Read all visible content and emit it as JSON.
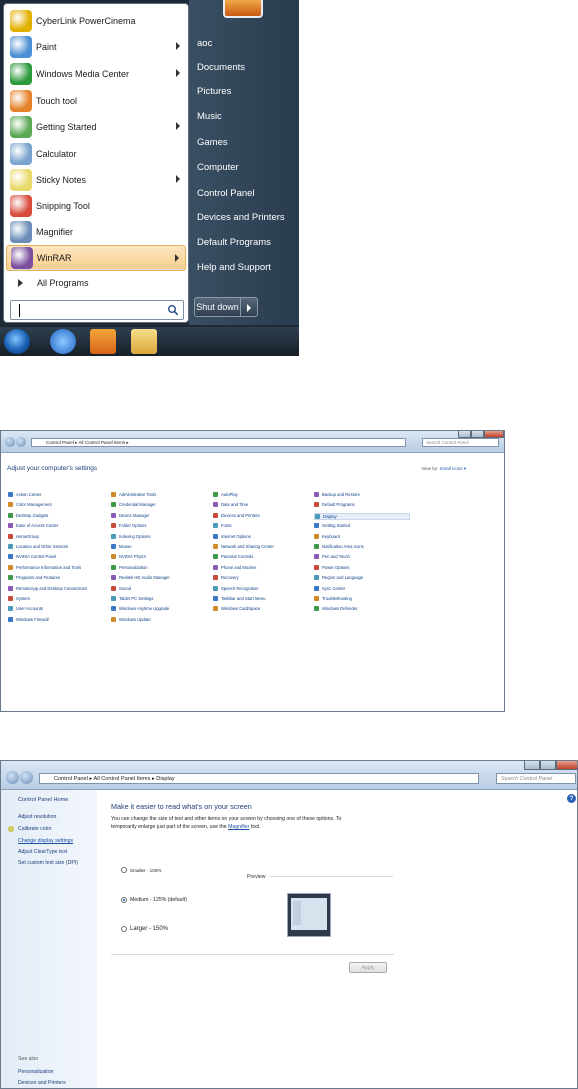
{
  "start_menu": {
    "programs": [
      {
        "label": "CyberLink PowerCinema",
        "icon": "cyberlink-icon",
        "color": "#e2b000",
        "submenu": false,
        "highlighted": false
      },
      {
        "label": "Paint",
        "icon": "paint-icon",
        "color": "#4d8fd4",
        "submenu": true,
        "highlighted": false
      },
      {
        "label": "Windows Media Center",
        "icon": "media-center-icon",
        "color": "#2d9a3c",
        "submenu": true,
        "highlighted": false
      },
      {
        "label": "Touch tool",
        "icon": "touch-tool-icon",
        "color": "#e5822a",
        "submenu": false,
        "highlighted": false
      },
      {
        "label": "Getting Started",
        "icon": "getting-started-icon",
        "color": "#5ba855",
        "submenu": true,
        "highlighted": false
      },
      {
        "label": "Calculator",
        "icon": "calculator-icon",
        "color": "#7aa3cf",
        "submenu": false,
        "highlighted": false
      },
      {
        "label": "Sticky Notes",
        "icon": "sticky-notes-icon",
        "color": "#e8d96a",
        "submenu": true,
        "highlighted": false
      },
      {
        "label": "Snipping Tool",
        "icon": "snipping-tool-icon",
        "color": "#d94c3c",
        "submenu": false,
        "highlighted": false
      },
      {
        "label": "Magnifier",
        "icon": "magnifier-icon",
        "color": "#6b8db8",
        "submenu": false,
        "highlighted": false
      },
      {
        "label": "WinRAR",
        "icon": "winrar-icon",
        "color": "#7b4f9d",
        "submenu": true,
        "highlighted": true
      }
    ],
    "all_programs": "All Programs",
    "right_items": [
      "aoc",
      "Documents",
      "Pictures",
      "Music",
      "Games",
      "Computer",
      "Control Panel",
      "Devices and Printers",
      "Default Programs",
      "Help and Support"
    ],
    "shutdown": "Shut down"
  },
  "control_panel": {
    "address": "Control Panel ▸ All Control Panel Items ▸",
    "search_placeholder": "Search Control Panel",
    "heading": "Adjust your computer's settings",
    "view_by": "View by:",
    "view_by_value": "Small icons ▾",
    "columns": [
      [
        "Action Center",
        "Color Management",
        "Desktop Gadgets",
        "Ease of Access Center",
        "HomeGroup",
        "Location and Other Sensors",
        "NVIDIA Control Panel",
        "Performance Information and Tools",
        "Programs and Features",
        "RemoteApp and Desktop Connections",
        "System",
        "User Accounts",
        "Windows Firewall"
      ],
      [
        "Administrative Tools",
        "Credential Manager",
        "Device Manager",
        "Folder Options",
        "Indexing Options",
        "Mouse",
        "NVIDIA PhysX",
        "Personalization",
        "Realtek HD Audio Manager",
        "Sound",
        "Tablet PC Settings",
        "Windows Anytime Upgrade",
        "Windows Update"
      ],
      [
        "AutoPlay",
        "Date and Time",
        "Devices and Printers",
        "Fonts",
        "Internet Options",
        "Network and Sharing Center",
        "Parental Controls",
        "Phone and Modem",
        "Recovery",
        "Speech Recognition",
        "Taskbar and Start Menu",
        "Windows CardSpace"
      ],
      [
        "Backup and Restore",
        "Default Programs",
        "Display",
        "Getting Started",
        "Keyboard",
        "Notification Area Icons",
        "Pen and Touch",
        "Power Options",
        "Region and Language",
        "Sync Center",
        "Troubleshooting",
        "Windows Defender"
      ]
    ],
    "icon_colors": [
      "#3a78c8",
      "#d08a2a",
      "#3d9a4a",
      "#8a5ab8",
      "#c84a3a",
      "#4a9ab8"
    ],
    "selected_item": "Display"
  },
  "display": {
    "address": "Control Panel ▸ All Control Panel Items ▸ Display",
    "search_placeholder": "Search Control Panel",
    "sidebar": [
      "Control Panel Home",
      "Adjust resolution",
      "Calibrate color",
      "Change display settings",
      "Adjust ClearType text",
      "Set custom text size (DPI)"
    ],
    "see_also_heading": "See also",
    "see_also": [
      "Personalization",
      "Devices and Printers"
    ],
    "title": "Make it easier to read what's on your screen",
    "body_line1": "You can change the size of text and other items on your screen by choosing one of these options. To",
    "body_line2_prefix": "temporarily enlarge just part of the screen, use the",
    "body_link": "Magnifier",
    "body_line2_suffix": "tool.",
    "options": [
      "Smaller - 100%",
      "Medium - 125% (default)",
      "Larger - 150%"
    ],
    "selected_option": "Medium - 125% (default)",
    "preview_label": "Preview",
    "apply": "Apply",
    "help": "?"
  }
}
